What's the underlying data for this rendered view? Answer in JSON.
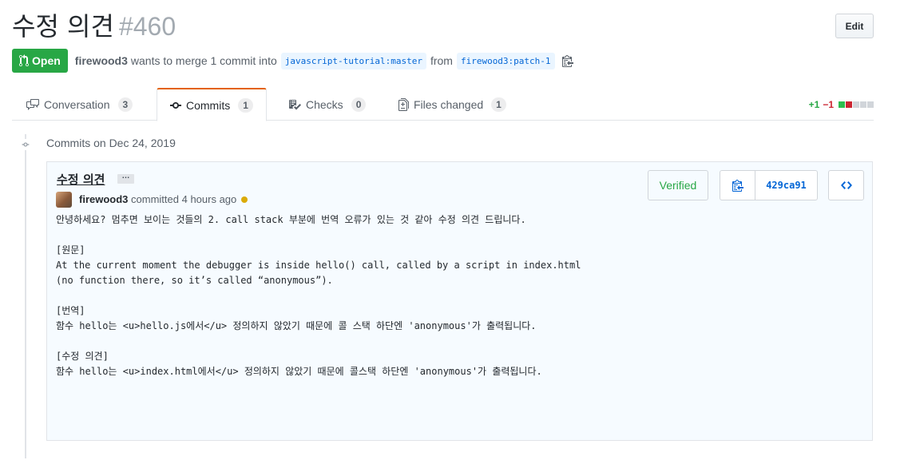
{
  "pr": {
    "title": "수정 의견",
    "number": "#460",
    "edit_label": "Edit",
    "state": "Open",
    "author": "firewood3",
    "merge_text": "wants to merge 1 commit into",
    "base_branch": "javascript-tutorial:master",
    "from_text": "from",
    "head_branch": "firewood3:patch-1"
  },
  "tabs": [
    {
      "label": "Conversation",
      "count": "3",
      "icon": "comment-discussion-icon"
    },
    {
      "label": "Commits",
      "count": "1",
      "icon": "git-commit-icon"
    },
    {
      "label": "Checks",
      "count": "0",
      "icon": "checklist-icon"
    },
    {
      "label": "Files changed",
      "count": "1",
      "icon": "file-diff-icon"
    }
  ],
  "diffstat": {
    "additions": "+1",
    "deletions": "−1"
  },
  "timeline": {
    "group_title": "Commits on Dec 24, 2019"
  },
  "commit": {
    "title": "수정 의견",
    "ellipsis": "…",
    "author": "firewood3",
    "meta": "committed 4 hours ago",
    "verified_label": "Verified",
    "sha": "429ca91",
    "body": "안녕하세요? 멈추면 보이는 것들의 2. call stack 부분에 번역 오류가 있는 것 같아 수정 의견 드립니다.\n\n[원문]\nAt the current moment the debugger is inside hello() call, called by a script in index.html (no function there, so it’s called “anonymous”).\n\n[번역]\n함수 hello는 <u>hello.js에서</u> 정의하지 않았기 때문에 콜 스택 하단엔 'anonymous'가 출력됩니다.\n\n[수정 의견]\n함수 hello는 <u>index.html에서</u> 정의하지 않았기 때문에 콜스택 하단엔 'anonymous'가 출력됩니다."
  },
  "colors": {
    "green": "#28a745",
    "red": "#cb2431",
    "link": "#0366d6",
    "pending": "#dbab09"
  }
}
